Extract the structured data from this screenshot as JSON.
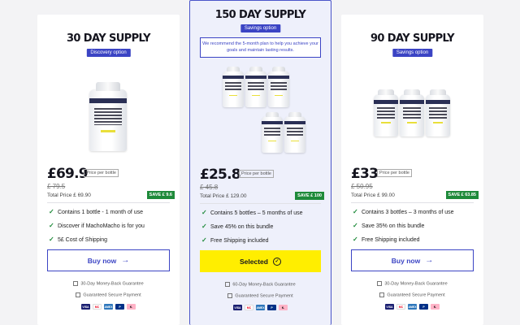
{
  "plans": [
    {
      "title": "30 DAY SUPPLY",
      "badge": "Discovery option",
      "price": "£69.9",
      "price_per": "Price per bottle",
      "old_price": "£ 79.5",
      "total": "Total Price £ 69.90",
      "save": "SAVE £ 9.6",
      "features": [
        "Contains 1 bottle - 1 month of use",
        "Discover if MachoMacho is for you",
        "5£ Cost of Shipping"
      ],
      "button": "Buy now",
      "button_icon": "arrow-right-icon",
      "bottles": 1
    },
    {
      "title": "150 DAY SUPPLY",
      "badge": "Savings option",
      "recommendation": "We recommend the 5-month plan to help you achieve your goals and maintain lasting results.",
      "price": "£25.8",
      "price_per": "Price per bottle",
      "old_price": "£ 45.8",
      "total": "Total Price £ 129.00",
      "save": "SAVE £ 100",
      "features": [
        "Contains 5 bottles – 5 months of use",
        "Save 45% on this bundle",
        "Free Shipping included"
      ],
      "button": "Selected",
      "button_icon": "check-circle-icon",
      "bottles": 5
    },
    {
      "title": "90 DAY SUPPLY",
      "badge": "Savings option",
      "price": "£33",
      "price_per": "Price per bottle",
      "old_price": "£ 50.95",
      "total": "Total Price £ 99.00",
      "save": "SAVE £ 63.85",
      "features": [
        "Contains 3 bottles – 3 months of use",
        "Save 35% on this bundle",
        "Free Shipping included"
      ],
      "button": "Buy now",
      "button_icon": "arrow-right-icon",
      "bottles": 3
    }
  ],
  "guarantees": {
    "money_back": "30-Day Money-Back Guarantee",
    "money_back_150": "60-Day Money-Back Guarantee",
    "secure": "Guaranteed Secure Payment"
  },
  "payment_methods": [
    {
      "name": "VISA",
      "color": "#1a1f71"
    },
    {
      "name": "MC",
      "color": "#eb001b"
    },
    {
      "name": "AMEX",
      "color": "#2e77bc"
    },
    {
      "name": "P",
      "color": "#003087"
    },
    {
      "name": "K.",
      "color": "#ffb3c7"
    }
  ],
  "colors": {
    "accent": "#3b44c4",
    "selected": "#ffee00",
    "save_green": "#1e8a3a"
  }
}
